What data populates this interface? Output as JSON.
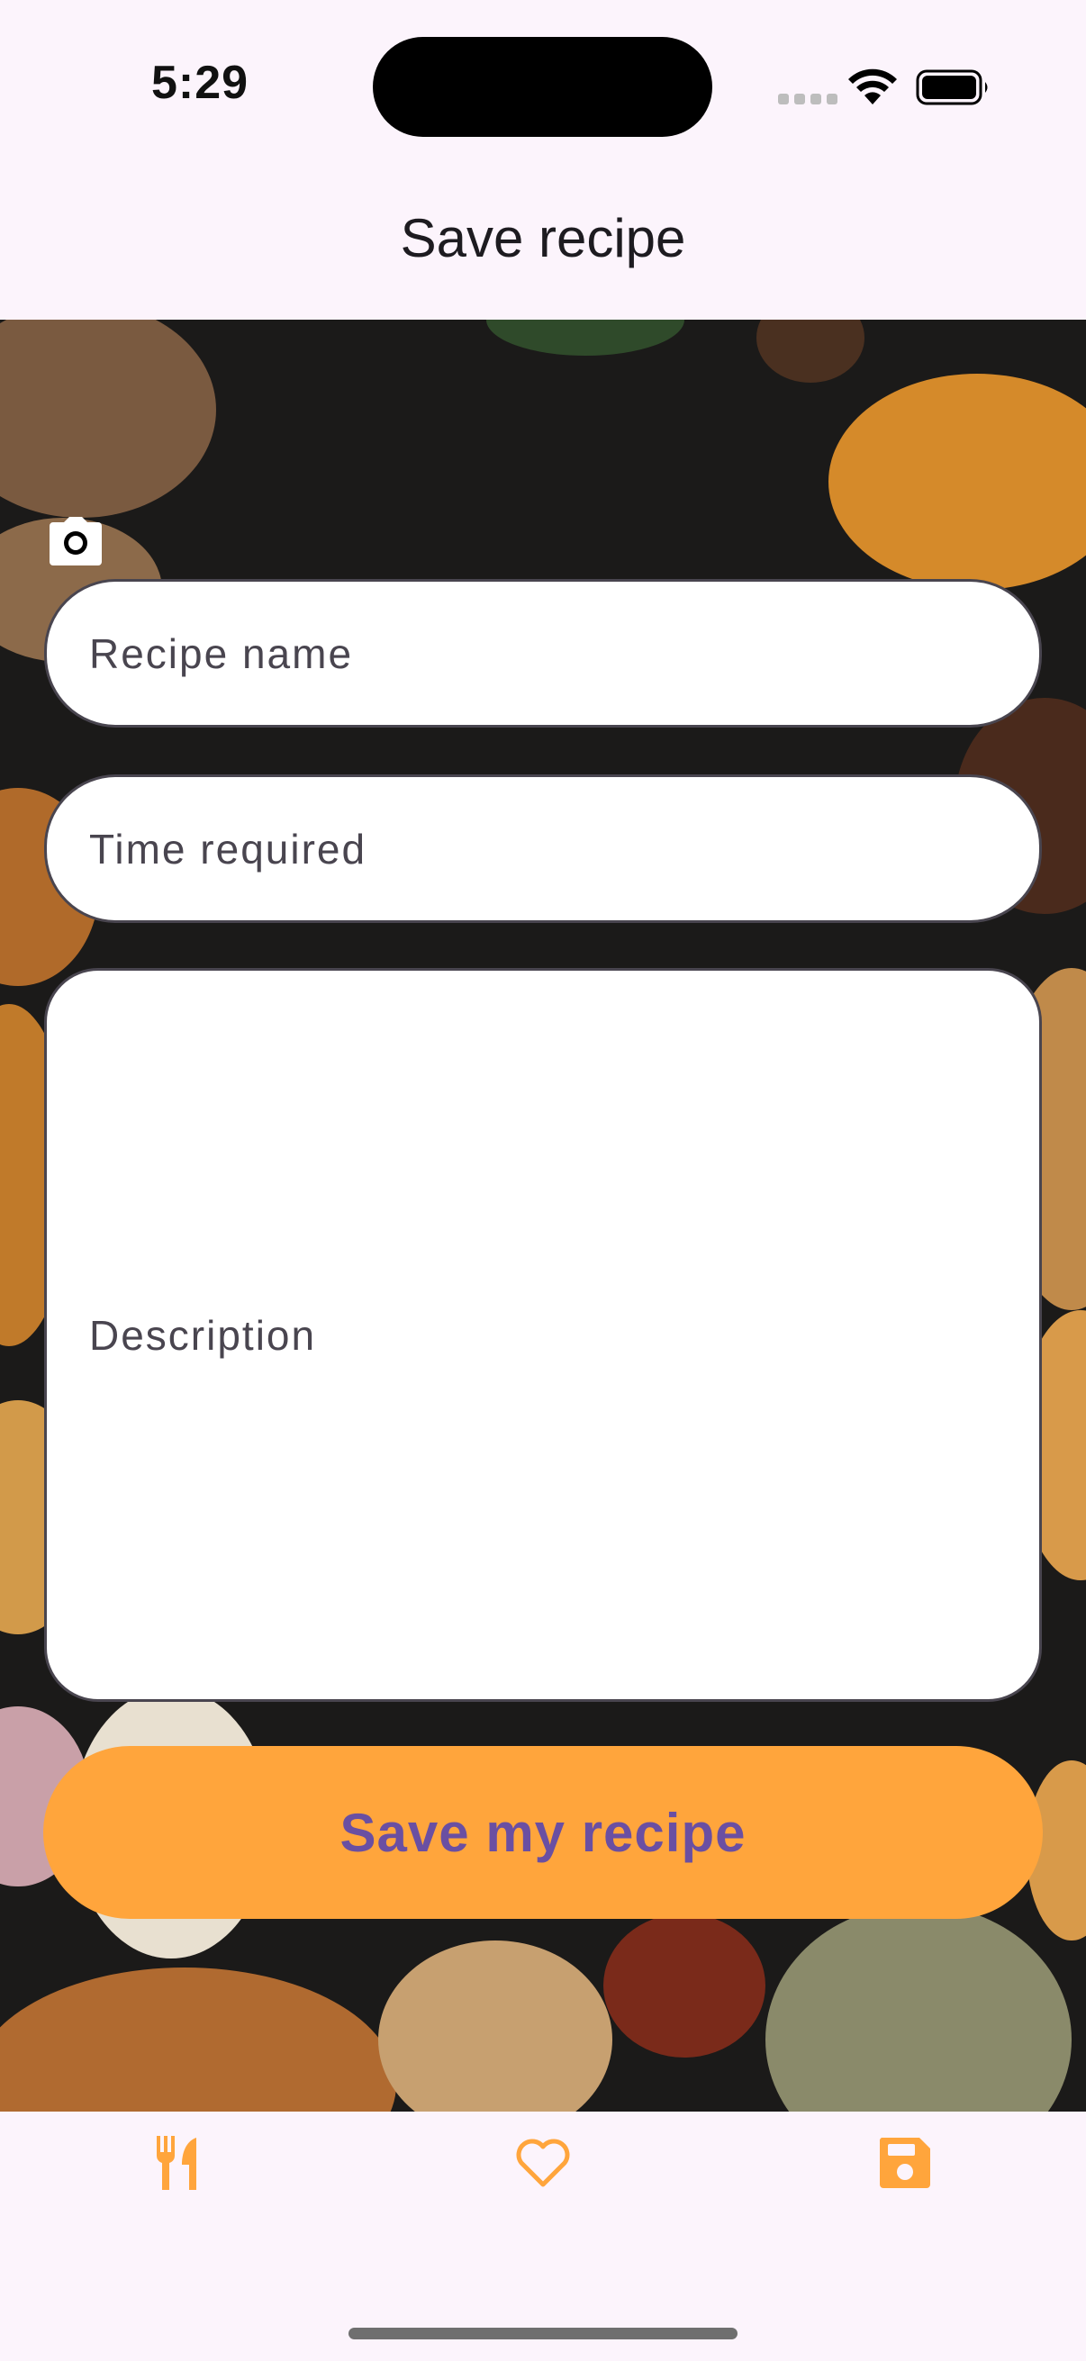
{
  "status_bar": {
    "time": "5:29"
  },
  "header": {
    "title": "Save recipe"
  },
  "form": {
    "recipe_name_label": "Recipe name",
    "time_required_label": "Time required",
    "description_label": "Description",
    "camera_icon": "camera-icon"
  },
  "actions": {
    "save_label": "Save my recipe"
  },
  "bottom_nav": {
    "items": [
      {
        "icon": "fork-knife-icon"
      },
      {
        "icon": "heart-icon"
      },
      {
        "icon": "floppy-disk-icon"
      }
    ]
  },
  "colors": {
    "accent": "#FFA53C",
    "button_text": "#6A4FA2",
    "background": "#FCF4FC"
  }
}
